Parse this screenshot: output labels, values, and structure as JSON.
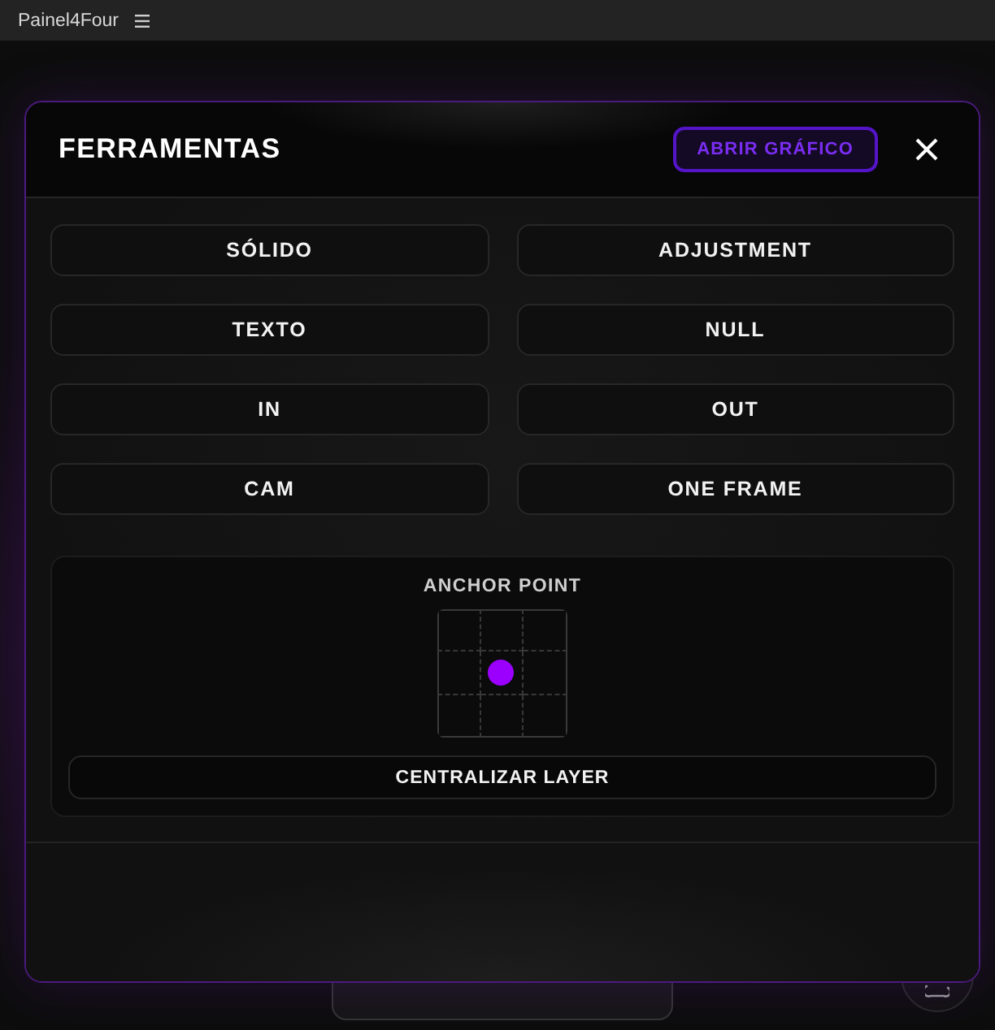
{
  "app_bar": {
    "title": "Painel4Four"
  },
  "dialog": {
    "title": "FERRAMENTAS",
    "header_button": "ABRIR GRÁFICO"
  },
  "tools": [
    {
      "label": "SÓLIDO"
    },
    {
      "label": "ADJUSTMENT"
    },
    {
      "label": "TEXTO"
    },
    {
      "label": "NULL"
    },
    {
      "label": "IN"
    },
    {
      "label": "OUT"
    },
    {
      "label": "CAM"
    },
    {
      "label": "ONE FRAME"
    }
  ],
  "anchor": {
    "label": "ANCHOR POINT",
    "cells": [
      {
        "selected": false
      },
      {
        "selected": false
      },
      {
        "selected": false
      },
      {
        "selected": false
      },
      {
        "selected": true
      },
      {
        "selected": false
      },
      {
        "selected": false
      },
      {
        "selected": false
      },
      {
        "selected": false
      }
    ],
    "button": "CENTRALIZAR LAYER"
  }
}
